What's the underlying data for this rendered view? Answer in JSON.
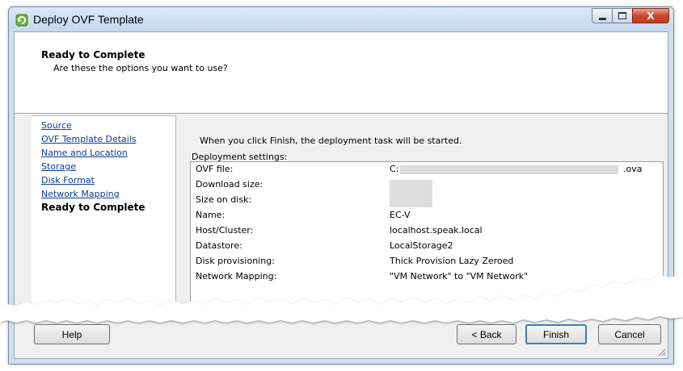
{
  "window": {
    "title": "Deploy OVF Template",
    "controls": {
      "minimize": "—",
      "maximize": "☐",
      "close": "X"
    }
  },
  "header": {
    "title": "Ready to Complete",
    "subtitle": "Are these the options you want to use?"
  },
  "steps": [
    {
      "label": "Source",
      "current": false
    },
    {
      "label": "OVF Template Details",
      "current": false
    },
    {
      "label": "Name and Location",
      "current": false
    },
    {
      "label": "Storage",
      "current": false
    },
    {
      "label": "Disk Format",
      "current": false
    },
    {
      "label": "Network Mapping",
      "current": false
    },
    {
      "label": "Ready to Complete",
      "current": true
    }
  ],
  "main": {
    "intro": "When you click Finish, the deployment task will be started.",
    "settings_label": "Deployment settings:",
    "settings": [
      {
        "key": "OVF file:",
        "value": "C:",
        "suffix": ".ova"
      },
      {
        "key": "Download size:",
        "value": ""
      },
      {
        "key": "Size on disk:",
        "value": ""
      },
      {
        "key": "Name:",
        "value": "EC-V"
      },
      {
        "key": "Host/Cluster:",
        "value": "localhost.speak.local"
      },
      {
        "key": "Datastore:",
        "value": "LocalStorage2"
      },
      {
        "key": "Disk provisioning:",
        "value": "Thick Provision Lazy Zeroed"
      },
      {
        "key": "Network Mapping:",
        "value": "\"VM Network\" to \"VM Network\""
      }
    ]
  },
  "buttons": {
    "help": "Help",
    "back": "< Back",
    "finish": "Finish",
    "cancel": "Cancel"
  },
  "colors": {
    "link": "#0b3c96",
    "frame": "#cfdff0",
    "dialog_bg": "#f0f0f0"
  }
}
